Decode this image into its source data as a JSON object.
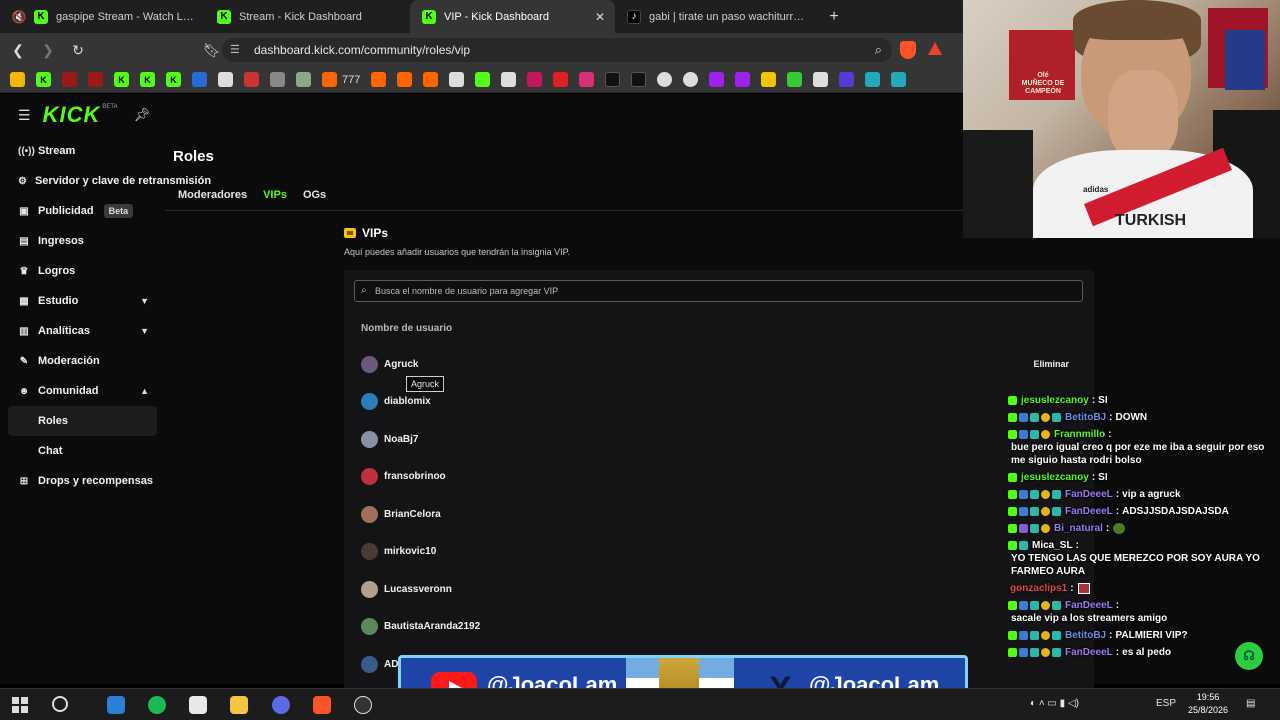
{
  "browser": {
    "tabs": [
      {
        "label": "gaspipe Stream - Watch Live on Kick",
        "favicon": "kick"
      },
      {
        "label": "Stream - Kick Dashboard",
        "favicon": "kick"
      },
      {
        "label": "VIP - Kick Dashboard",
        "favicon": "kick",
        "active": true
      },
      {
        "label": "gabi | tirate un paso wachiturros | TikTok",
        "favicon": "tiktok"
      }
    ],
    "new_tab": "+",
    "close_glyph": "✕",
    "url": "dashboard.kick.com/community/roles/vip",
    "bookmark_text": "777"
  },
  "kick": {
    "logo": "KICK",
    "logo_sup": "BETA",
    "brand_color": "#53fc18"
  },
  "sidebar": {
    "items": [
      {
        "label": "Stream",
        "icon": "signal-icon"
      },
      {
        "label": "Servidor y clave de retransmisión",
        "icon": "server-icon"
      },
      {
        "label": "Publicidad",
        "icon": "ad-icon",
        "badge": "Beta"
      },
      {
        "label": "Ingresos",
        "icon": "wallet-icon"
      },
      {
        "label": "Logros",
        "icon": "trophy-icon"
      },
      {
        "label": "Estudio",
        "icon": "studio-icon",
        "expandable": true
      },
      {
        "label": "Analíticas",
        "icon": "chart-icon",
        "expandable": true
      },
      {
        "label": "Moderación",
        "icon": "wrench-icon"
      },
      {
        "label": "Comunidad",
        "icon": "people-icon",
        "expanded": true
      },
      {
        "label": "Roles",
        "sub": true,
        "selected": true
      },
      {
        "label": "Chat",
        "sub": true
      },
      {
        "label": "Drops y recompensas",
        "icon": "gift-icon"
      }
    ]
  },
  "page": {
    "title": "Roles",
    "tabs": [
      {
        "label": "Moderadores"
      },
      {
        "label": "VIPs",
        "active": true
      },
      {
        "label": "OGs"
      }
    ],
    "section_title": "VIPs",
    "section_desc": "Aquí puedes añadir usuarios que tendrán la insignia VIP.",
    "search_placeholder": "Busca el nombre de usuario para agregar VIP",
    "column_header": "Nombre de usuario",
    "remove_label": "Eliminar",
    "tooltip": "Agruck",
    "users": [
      {
        "name": "Agruck",
        "color": "#6a5a7a"
      },
      {
        "name": "diablomix",
        "color": "#2a7fb8"
      },
      {
        "name": "NoaBj7",
        "color": "#8a8fa8"
      },
      {
        "name": "fransobrinoo",
        "color": "#c03040"
      },
      {
        "name": "BrianCelora",
        "color": "#a0705a"
      },
      {
        "name": "mirkovic10",
        "color": "#4a3a3a"
      },
      {
        "name": "Lucassveronn",
        "color": "#b0a090"
      },
      {
        "name": "BautistaAranda2192",
        "color": "#5a8a5a"
      },
      {
        "name": "AD",
        "color": "#3a5a8a"
      }
    ]
  },
  "webcam": {
    "poster_text": "MUÑECO DE CAMPEÓN",
    "poster_brand": "Olé",
    "shirt_text": "TURKISH",
    "shirt_brand": "adidas"
  },
  "chat": {
    "messages": [
      {
        "user": "jesuslezcanoy",
        "color": "#53fc18",
        "text": "SI",
        "badges": [
          "b-kick"
        ]
      },
      {
        "user": "BetitoBJ",
        "color": "#6a8ee8",
        "text": "DOWN",
        "badges": [
          "b-kick",
          "b-blue",
          "b-teal",
          "b-gold",
          "b-teal"
        ]
      },
      {
        "user": "Frannmillo",
        "color": "#53fc18",
        "text": "bue pero igual creo q por eze me iba a seguir por eso me siguio hasta rodri bolso",
        "badges": [
          "b-kick",
          "b-blue",
          "b-teal",
          "b-gold"
        ]
      },
      {
        "user": "jesuslezcanoy",
        "color": "#53fc18",
        "text": "SI",
        "badges": [
          "b-kick"
        ]
      },
      {
        "user": "FanDeeeL",
        "color": "#9a7af0",
        "text": "vip a agruck",
        "badges": [
          "b-kick",
          "b-blue",
          "b-teal",
          "b-gold",
          "b-teal"
        ]
      },
      {
        "user": "FanDeeeL",
        "color": "#9a7af0",
        "text": "ADSJJSDAJSDAJSDA",
        "badges": [
          "b-kick",
          "b-blue",
          "b-teal",
          "b-gold",
          "b-teal"
        ]
      },
      {
        "user": "Bi_natural",
        "color": "#9a7af0",
        "text": "",
        "badges": [
          "b-kick",
          "b-purple",
          "b-teal",
          "b-gold"
        ],
        "emote": "green"
      },
      {
        "user": "Mica_SL",
        "color": "#ffffff",
        "text": "YO TENGO LAS QUE MEREZCO POR SOY AURA YO FARMEO AURA",
        "badges": [
          "b-kick",
          "b-teal"
        ]
      },
      {
        "user": "gonzaclips1",
        "color": "#e04848",
        "text": "",
        "badges": [],
        "emote": "red"
      },
      {
        "user": "FanDeeeL",
        "color": "#9a7af0",
        "text": "sacale vip a los streamers amigo",
        "badges": [
          "b-kick",
          "b-blue",
          "b-teal",
          "b-gold",
          "b-teal"
        ]
      },
      {
        "user": "BetitoBJ",
        "color": "#6a8ee8",
        "text": "PALMIERI VIP?",
        "badges": [
          "b-kick",
          "b-blue",
          "b-teal",
          "b-gold",
          "b-teal"
        ]
      },
      {
        "user": "FanDeeeL",
        "color": "#9a7af0",
        "text": "es al pedo",
        "badges": [
          "b-kick",
          "b-blue",
          "b-teal",
          "b-gold",
          "b-teal"
        ]
      }
    ]
  },
  "banner": {
    "youtube_handle": "@JoacoLam_",
    "x_glyph": "X",
    "x_handle": "@JoacoLam"
  },
  "taskbar": {
    "lang": "ESP",
    "time": "19:56",
    "date": "25/8/2026"
  }
}
